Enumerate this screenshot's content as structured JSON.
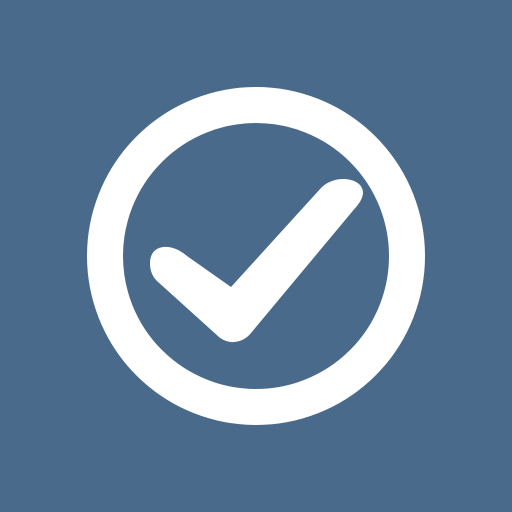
{
  "icon": {
    "name": "check-circle-icon",
    "background_color": "#4a6a8c",
    "foreground_color": "#ffffff"
  }
}
